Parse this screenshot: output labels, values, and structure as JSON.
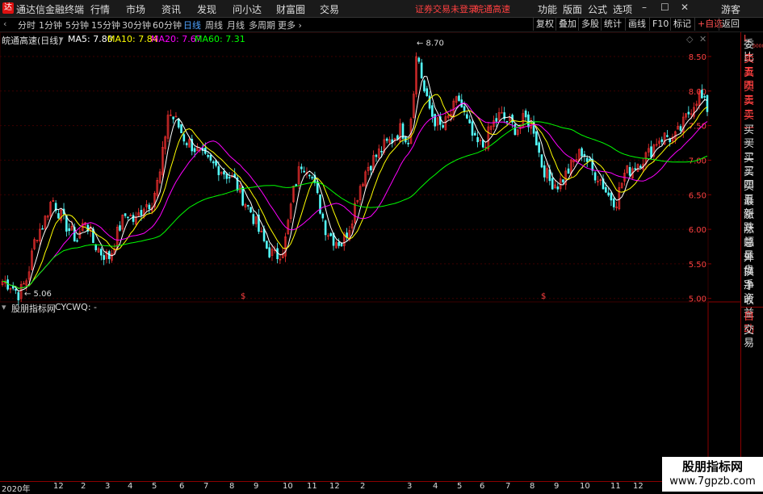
{
  "menubar": {
    "app_title": "通达信金融终端",
    "menus": [
      "行情",
      "市场",
      "资讯",
      "发现",
      "问小达",
      "财富圈",
      "交易"
    ],
    "notice": "证券交易未登录",
    "stock_name": "皖通高速",
    "right_menus": [
      "功能",
      "版面",
      "公式",
      "选项"
    ],
    "user": "游客"
  },
  "timeframes": [
    "分时",
    "1分钟",
    "5分钟",
    "15分钟",
    "30分钟",
    "60分钟",
    "日线",
    "周线",
    "月线",
    "多周期",
    "更多 ›"
  ],
  "active_timeframe": "日线",
  "toolbar_buttons": [
    "复权",
    "叠加",
    "多股",
    "统计",
    "画线",
    "F10",
    "标记",
    "+自选",
    "返回"
  ],
  "info": {
    "title": "皖通高速(日线)",
    "ma5": "MA5: 7.80",
    "ma10": "MA10: 7.84",
    "ma20": "MA20: 7.67",
    "ma60": "MA60: 7.31"
  },
  "price_axis": [
    "8.50",
    "8.00",
    "7.50",
    "7.00",
    "6.50",
    "6.00",
    "5.50",
    "5.00"
  ],
  "annotations": {
    "high": "8.70",
    "low": "5.06",
    "marker": "$"
  },
  "indicator": {
    "label": "股朋指标网",
    "formula": "CYCWQ: -"
  },
  "right_panel": {
    "top": "L",
    "top_sub": "0000",
    "items": [
      "委比",
      "卖五",
      "卖四",
      "卖三",
      "卖二",
      "卖一",
      "买一",
      "买二",
      "买三",
      "买四",
      "买五",
      "最新",
      "涨跌",
      "涨幅",
      "总量",
      "外盘",
      "换手",
      "净资",
      "收益"
    ],
    "bottom": [
      "自动",
      "交易"
    ]
  },
  "dates": [
    "2020年",
    "12",
    "2",
    "3",
    "4",
    "5",
    "6",
    "7",
    "8",
    "9",
    "10",
    "11",
    "12",
    "2",
    "3",
    "4",
    "5",
    "6",
    "7",
    "8",
    "9",
    "10",
    "11",
    "12"
  ],
  "watermark": {
    "line1": "股朋指标网",
    "line2": "www.7gpzb.com"
  },
  "colors": {
    "up": "#ff3232",
    "down": "#54ffff",
    "ma5": "#ffffff",
    "ma10": "#ffff00",
    "ma20": "#ff00ff",
    "ma60": "#00ff00",
    "grid": "#8b0000"
  },
  "chart_data": {
    "type": "candlestick",
    "y_range": [
      4.95,
      8.85
    ],
    "ylabels": [
      "8.50",
      "8.00",
      "7.50",
      "7.00",
      "6.50",
      "6.00",
      "5.50",
      "5.00"
    ],
    "close_path": [
      5.25,
      5.2,
      5.06,
      5.3,
      5.9,
      6.1,
      6.45,
      6.2,
      6.0,
      5.85,
      6.15,
      5.8,
      5.65,
      5.6,
      6.0,
      6.25,
      6.1,
      6.35,
      6.4,
      6.8,
      7.7,
      7.55,
      7.3,
      7.2,
      7.05,
      6.95,
      6.9,
      6.8,
      6.7,
      6.45,
      6.25,
      5.95,
      5.7,
      5.6,
      5.75,
      6.5,
      6.95,
      6.9,
      6.45,
      6.0,
      5.85,
      5.8,
      6.1,
      6.6,
      6.9,
      7.05,
      7.2,
      7.3,
      7.45,
      7.3,
      8.6,
      7.9,
      7.6,
      7.45,
      7.65,
      7.9,
      7.55,
      7.25,
      7.2,
      7.5,
      7.65,
      7.55,
      7.45,
      7.6,
      7.5,
      6.95,
      6.7,
      6.65,
      6.8,
      7.0,
      7.15,
      6.85,
      6.75,
      6.5,
      6.4,
      6.8,
      6.9,
      7.0,
      7.1,
      7.3,
      7.35,
      7.3,
      7.5,
      7.75,
      7.95,
      7.75
    ]
  }
}
